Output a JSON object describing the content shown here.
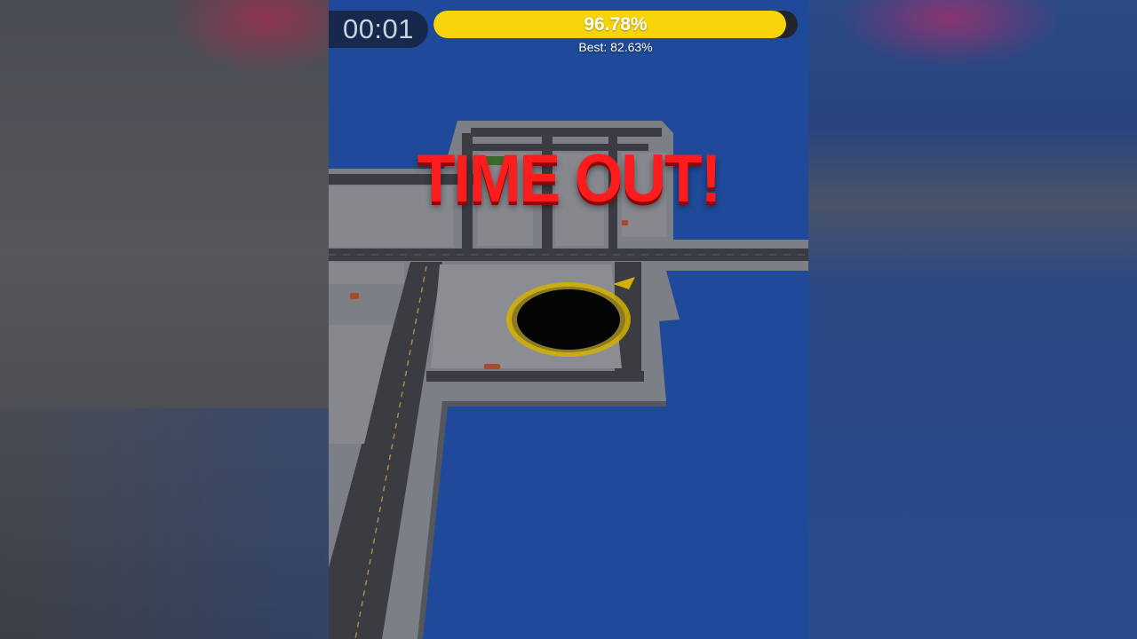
{
  "hud": {
    "timer": "00:01",
    "progress_label": "96.78%",
    "progress_value": 0.9678,
    "best_label": "Best: 82.63%"
  },
  "message": {
    "text": "TIME OUT!"
  },
  "colors": {
    "water": "#1e4a99",
    "progress_fill": "#f7d50a",
    "timeout_text": "#ff1c1c",
    "hole_ring": "#d4b000"
  },
  "icons": {
    "hole": "black-hole-player",
    "direction": "yellow-arrow-marker"
  }
}
